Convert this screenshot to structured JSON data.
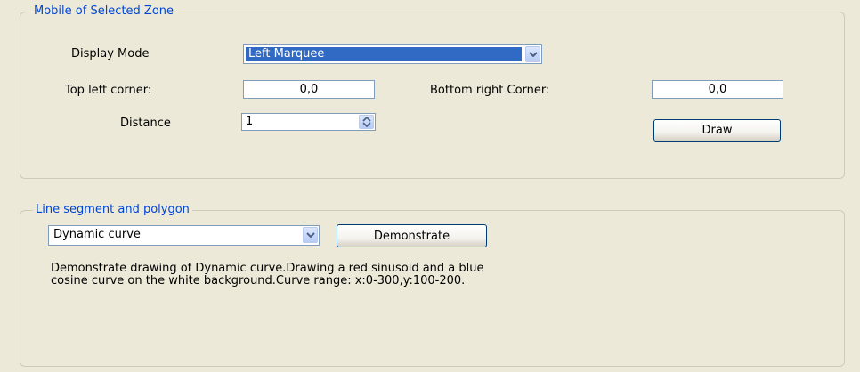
{
  "zone_group": {
    "title": "Mobile of Selected Zone",
    "display_mode_label": "Display Mode",
    "display_mode_value": "Left Marquee",
    "top_left_label": "Top left corner:",
    "top_left_value": "0,0",
    "bottom_right_label": "Bottom right Corner:",
    "bottom_right_value": "0,0",
    "distance_label": "Distance",
    "distance_value": "1",
    "draw_button": "Draw"
  },
  "line_group": {
    "title": "Line segment and polygon",
    "curve_value": "Dynamic curve",
    "demonstrate_button": "Demonstrate",
    "description": "Demonstrate drawing of Dynamic curve.Drawing a red sinusoid and a blue\ncosine curve on the white background.Curve range: x:0-300,y:100-200."
  },
  "icons": {
    "dropdown": "chevron-down-icon",
    "spinner": "up-down-arrows-icon"
  },
  "colors": {
    "background": "#ECE9D8",
    "group_title": "#0046D5",
    "selection": "#316AC5",
    "field_border": "#7F9DB9",
    "button_border": "#003C74"
  }
}
